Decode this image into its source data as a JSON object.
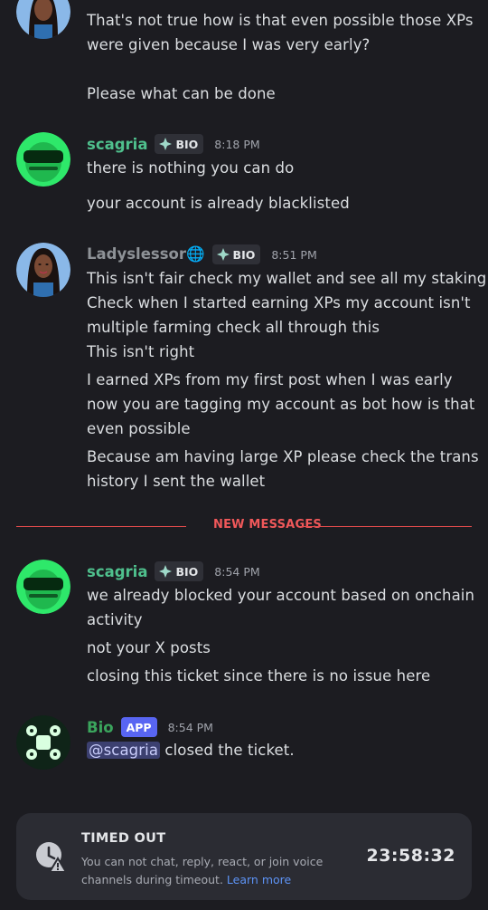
{
  "messages": {
    "first_continued": {
      "line1": "That's not true how is that even possible those XPs",
      "line2": "were given because I was very early?",
      "line3": "Please what can be done"
    },
    "scagria1": {
      "username": "scagria",
      "tag": "BIO",
      "time": "8:18 PM",
      "line1": "there is nothing you can do",
      "line2": "your account is already blacklisted"
    },
    "lady": {
      "username": "Ladyslessor🌐",
      "tag": "BIO",
      "time": "8:51 PM",
      "line1": "This isn't fair check my wallet and see all my staking",
      "line2": "Check when I started earning XPs  my account isn't",
      "line3": "multiple farming check all through this",
      "line4": "This isn't right",
      "line5": "I earned XPs from my first post when I was early",
      "line6": "now you are tagging my account as bot how is that",
      "line7": "even possible",
      "line8": "Because am having large XP please check the trans",
      "line9": "history I sent the wallet"
    },
    "divider": {
      "label": "NEW MESSAGES"
    },
    "scagria2": {
      "username": "scagria",
      "tag": "BIO",
      "time": "8:54 PM",
      "line1": "we already blocked your account based on onchain",
      "line2": "activity",
      "line3": "not your X posts",
      "line4": "closing this ticket since there is no issue here"
    },
    "bio": {
      "username": "Bio",
      "tag": "APP",
      "time": "8:54 PM",
      "mention": "@scagria",
      "text": " closed the ticket."
    }
  },
  "timeout": {
    "title": "TIMED OUT",
    "body": "You can not chat, reply, react, or join voice channels during timeout. ",
    "link": "Learn more",
    "timer": "23:58:32",
    "icon": "clock-warning-icon"
  },
  "colors": {
    "background": "#1c1c21",
    "scagria_name": "#4fc08d",
    "lady_name": "#8e9297",
    "bio_name": "#3ba55d",
    "new_messages": "#e14b4b",
    "app_badge": "#5865f2"
  }
}
